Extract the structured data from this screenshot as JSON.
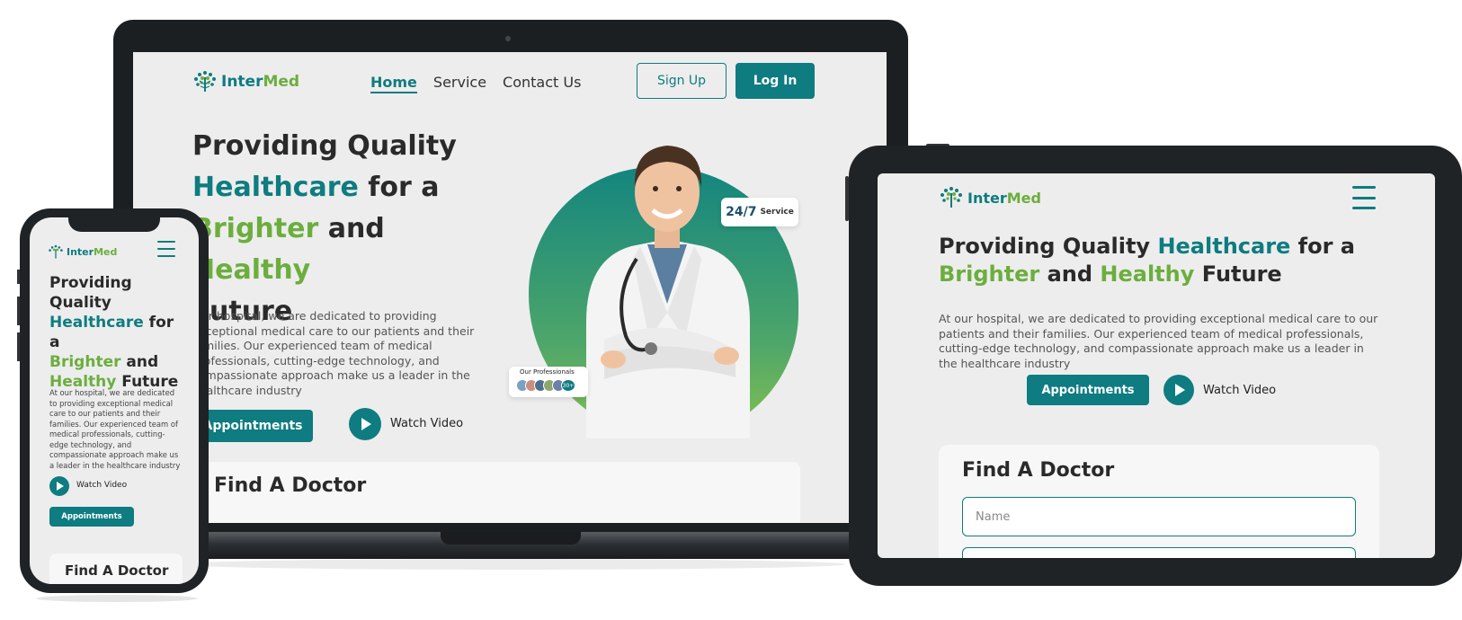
{
  "brand": {
    "name": "InterMed",
    "inter": "Inter",
    "med": "Med"
  },
  "nav": {
    "home": "Home",
    "service": "Service",
    "contact": "Contact Us",
    "signup": "Sign Up",
    "login": "Log In"
  },
  "hero": {
    "line1": "Providing Quality",
    "healthcare": "Healthcare",
    "for_a": " for a",
    "brighter": "Brighter",
    "and": " and ",
    "healthy": "Healthy",
    "future": "Future",
    "description": "At our hospital, we are dedicated to providing exceptional medical care to our patients and their families. Our experienced team of medical professionals, cutting-edge technology, and compassionate approach make us a leader in the healthcare industry",
    "laptop_description": "Our hospital, we are dedicated to providing exceptional medical care to our patients and their families. Our experienced team of medical professionals, cutting-edge technology, and compassionate approach make us a leader in the healthcare industry",
    "appointments": "Appointments",
    "watch_video": "Watch Video"
  },
  "badges": {
    "service_num": "24/7",
    "service_label": "Service",
    "professionals": "Our Professionals",
    "more": "30+"
  },
  "find_doctor": {
    "title": "Find A Doctor",
    "name_placeholder": "Name"
  },
  "colors": {
    "teal": "#0e7c80",
    "green": "#6cae3e",
    "screen_bg": "#ededed"
  }
}
